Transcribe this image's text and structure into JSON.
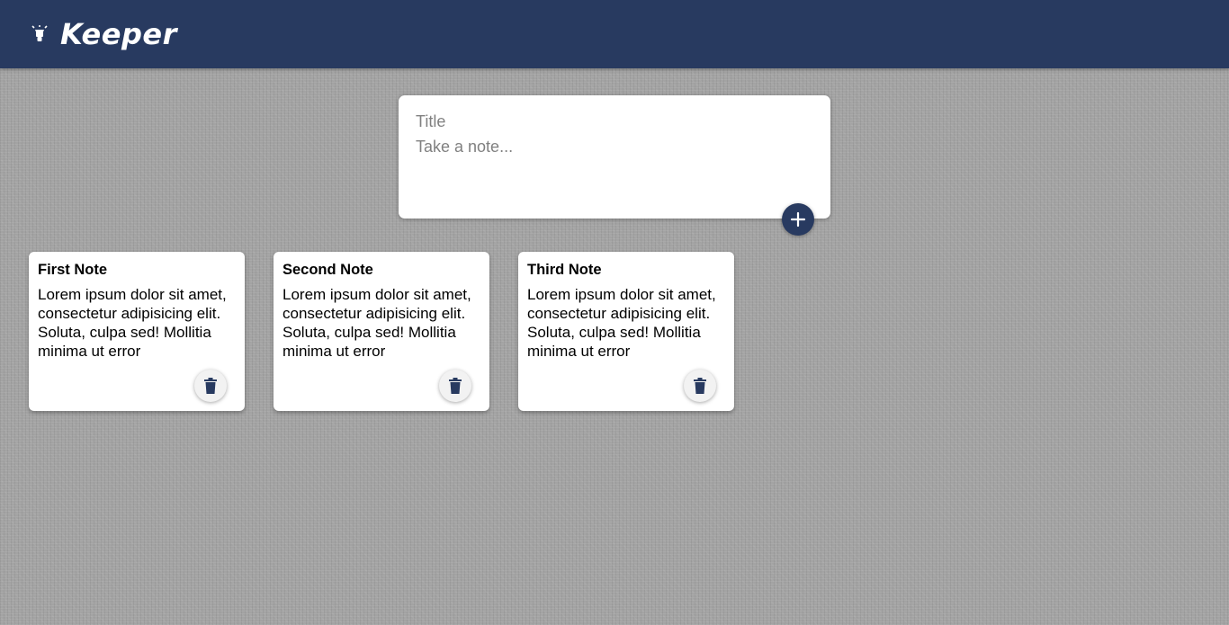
{
  "header": {
    "app_title": "Keeper",
    "logo_icon": "lightbulb-icon",
    "background_color": "#283a60"
  },
  "create_area": {
    "title_placeholder": "Title",
    "content_placeholder": "Take a note...",
    "add_icon": "plus-icon"
  },
  "notes": [
    {
      "title": "First Note",
      "content": "Lorem ipsum dolor sit amet, consectetur adipisicing elit. Soluta, culpa sed! Mollitia minima ut error",
      "delete_icon": "trash-icon"
    },
    {
      "title": "Second Note",
      "content": "Lorem ipsum dolor sit amet, consectetur adipisicing elit. Soluta, culpa sed! Mollitia minima ut error",
      "delete_icon": "trash-icon"
    },
    {
      "title": "Third Note",
      "content": "Lorem ipsum dolor sit amet, consectetur adipisicing elit. Soluta, culpa sed! Mollitia minima ut error",
      "delete_icon": "trash-icon"
    }
  ],
  "colors": {
    "accent": "#283a60",
    "card": "#ffffff"
  }
}
